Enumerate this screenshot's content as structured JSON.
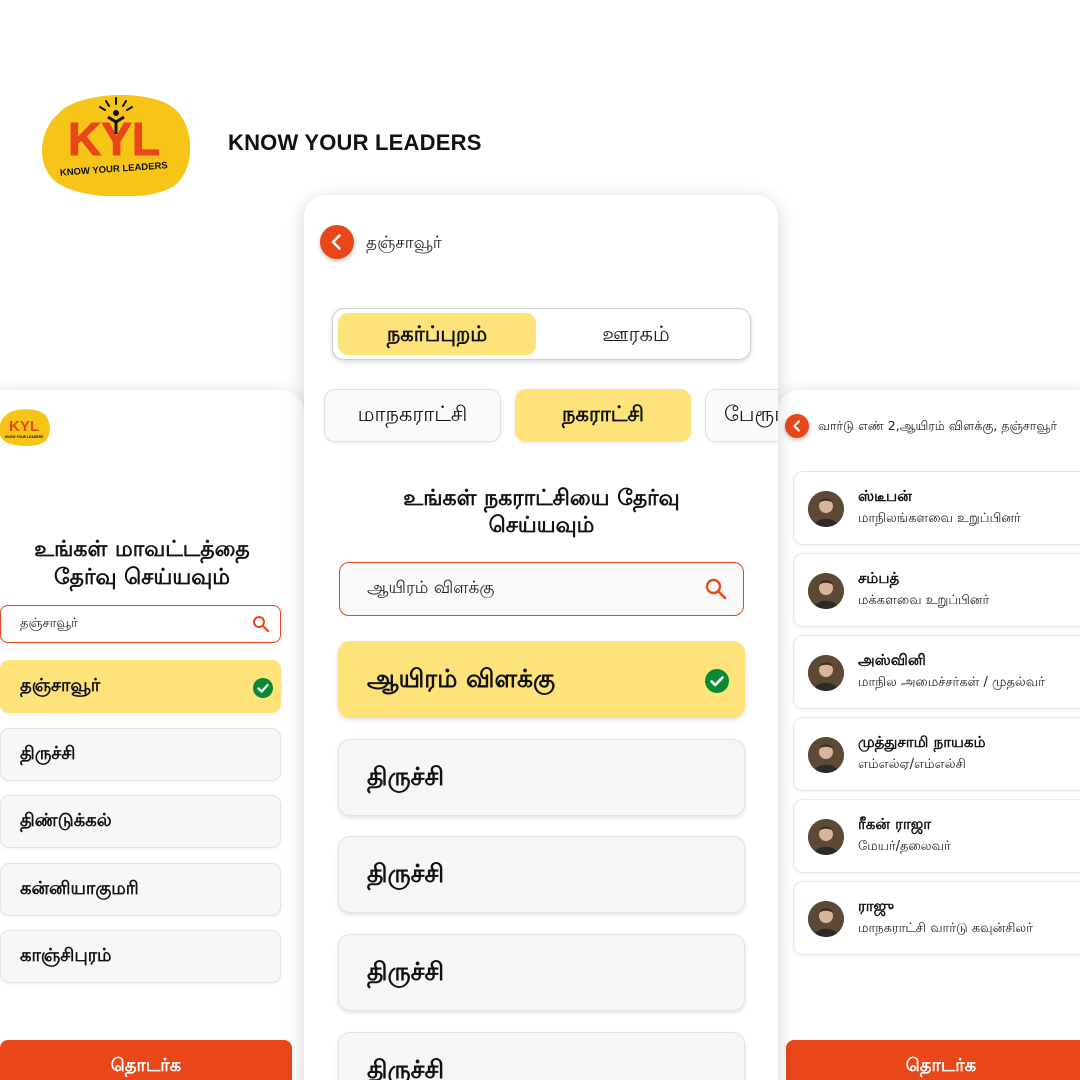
{
  "brand": {
    "logo_text": "KYL",
    "logo_tagline": "KNOW YOUR LEADERS",
    "title": "KNOW YOUR LEADERS",
    "yellow": "#f6c518",
    "orange": "#e9471a"
  },
  "left_screen": {
    "heading_line1": "உங்கள் மாவட்டத்தை",
    "heading_line2": "தேர்வு செய்யவும்",
    "search_value": "தஞ்சாவூர்",
    "districts": [
      {
        "label": "தஞ்சாவூர்",
        "selected": true
      },
      {
        "label": "திருச்சி",
        "selected": false
      },
      {
        "label": "திண்டுக்கல்",
        "selected": false
      },
      {
        "label": "கன்னியாகுமரி",
        "selected": false
      },
      {
        "label": "காஞ்சிபுரம்",
        "selected": false
      }
    ],
    "cta_label": "தொடர்க"
  },
  "center_screen": {
    "title": "தஞ்சாவூர்",
    "segments": {
      "active": "நகர்ப்புறம்",
      "inactive": "ஊரகம்"
    },
    "chips": [
      {
        "label": "மாநகராட்சி",
        "active": false
      },
      {
        "label": "நகராட்சி",
        "active": true
      },
      {
        "label": "பேரூராட்சி",
        "active": false
      }
    ],
    "heading_line1": "உங்கள் நகராட்சியை  தேர்வு",
    "heading_line2": "செய்யவும்",
    "search_value": "ஆயிரம் விளக்கு",
    "options": [
      {
        "label": "ஆயிரம் விளக்கு",
        "selected": true
      },
      {
        "label": "திருச்சி",
        "selected": false
      },
      {
        "label": "திருச்சி",
        "selected": false
      },
      {
        "label": "திருச்சி",
        "selected": false
      },
      {
        "label": "திருச்சி",
        "selected": false
      }
    ]
  },
  "right_screen": {
    "title": "வார்டு எண் 2,ஆயிரம் விளக்கு, தஞ்சாவூர்",
    "leaders": [
      {
        "name": "ஸ்டீபன்",
        "role": "மாநிலங்களவை  உறுப்பினர்"
      },
      {
        "name": "சம்பத்",
        "role": "மக்களவை  உறுப்பினர்"
      },
      {
        "name": "அஸ்வினி",
        "role": "மாநில அமைச்சர்கள் / முதல்வர்"
      },
      {
        "name": "முத்துசாமி நாயகம்",
        "role": "எம்எல்ஏ/எம்எல்சி"
      },
      {
        "name": "ரீகன் ராஜா",
        "role": "மேயர்/தலைவர்"
      },
      {
        "name": "ராஜு",
        "role": "மாநகராட்சி வார்டு கவுன்சிலர்"
      }
    ],
    "cta_label": "தொடர்க"
  }
}
